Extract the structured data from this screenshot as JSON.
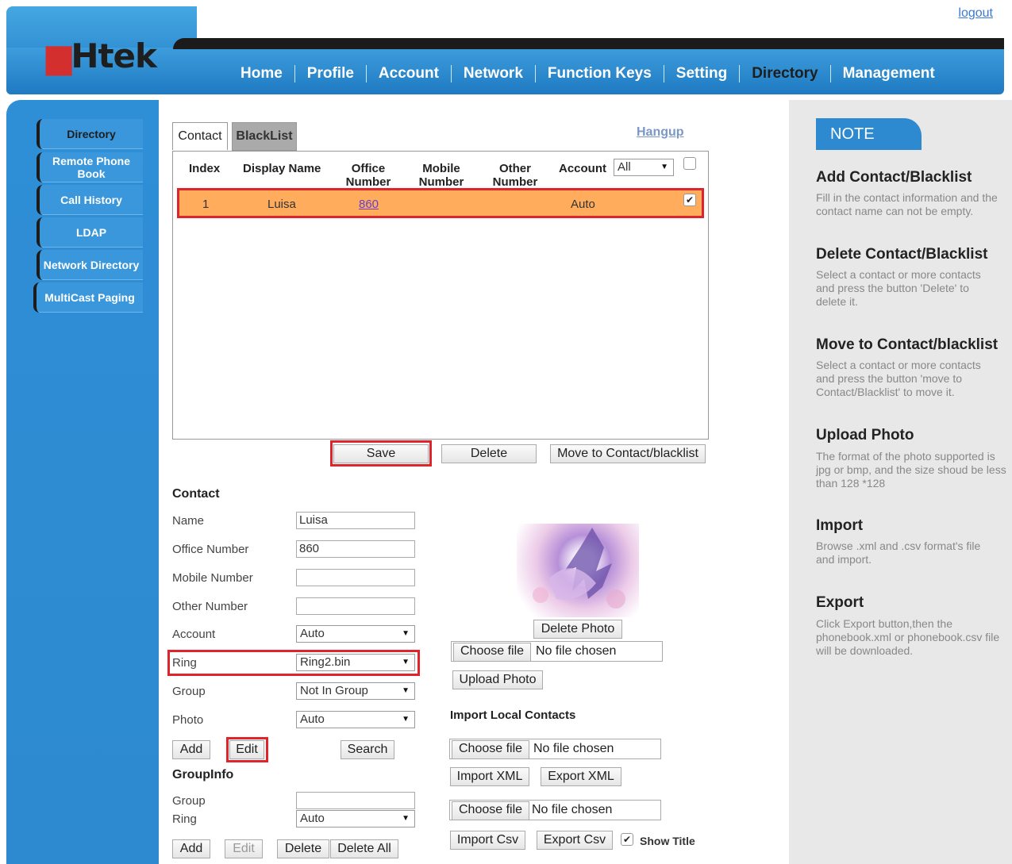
{
  "header": {
    "logo_text": "Htek",
    "logout": "logout",
    "nav": [
      "Home",
      "Profile",
      "Account",
      "Network",
      "Function Keys",
      "Setting",
      "Directory",
      "Management"
    ]
  },
  "sidebar": {
    "items": [
      "Directory",
      "Remote Phone Book",
      "Call History",
      "LDAP",
      "Network Directory",
      "MultiCast Paging"
    ]
  },
  "tabs": {
    "contact": "Contact",
    "blacklist": "BlackList",
    "hangup": "Hangup"
  },
  "table": {
    "headers": [
      "Index",
      "Display Name",
      "Office Number",
      "Mobile Number",
      "Other Number",
      "Account"
    ],
    "account_filter": "All",
    "rows": [
      {
        "index": "1",
        "name": "Luisa",
        "office": "860",
        "mobile": "",
        "other": "",
        "account": "Auto",
        "checked": true
      }
    ]
  },
  "list_buttons": {
    "save": "Save",
    "delete": "Delete",
    "move": "Move to Contact/blacklist"
  },
  "contact_form": {
    "title": "Contact",
    "name_label": "Name",
    "name_value": "Luisa",
    "office_label": "Office Number",
    "office_value": "860",
    "mobile_label": "Mobile Number",
    "mobile_value": "",
    "other_label": "Other Number",
    "other_value": "",
    "account_label": "Account",
    "account_value": "Auto",
    "ring_label": "Ring",
    "ring_value": "Ring2.bin",
    "group_label": "Group",
    "group_value": "Not In Group",
    "photo_label": "Photo",
    "photo_value": "Auto",
    "add": "Add",
    "edit": "Edit",
    "search": "Search"
  },
  "photo_panel": {
    "delete_photo": "Delete Photo",
    "choose_file": "Choose file",
    "no_file": "No file chosen",
    "upload_photo": "Upload Photo"
  },
  "import_panel": {
    "title": "Import Local Contacts",
    "choose_file": "Choose file",
    "no_file": "No file chosen",
    "import_xml": "Import XML",
    "export_xml": "Export XML",
    "import_csv": "Import Csv",
    "export_csv": "Export Csv",
    "show_title": "Show Title"
  },
  "groupinfo": {
    "title": "GroupInfo",
    "group_label": "Group",
    "group_value": "",
    "ring_label": "Ring",
    "ring_value": "Auto",
    "add": "Add",
    "edit": "Edit",
    "delete": "Delete",
    "delete_all": "Delete All"
  },
  "notes": {
    "badge": "NOTE",
    "sections": [
      {
        "title": "Add Contact/Blacklist",
        "text": "Fill in the contact information and the contact name can not be empty."
      },
      {
        "title": "Delete Contact/Blacklist",
        "text": "Select a contact or more contacts and press the button 'Delete' to delete it."
      },
      {
        "title": "Move to Contact/blacklist",
        "text": "Select a contact or more contacts and press the button 'move to Contact/Blacklist' to move it."
      },
      {
        "title": "Upload Photo",
        "text": "The format of the photo supported is jpg or bmp, and the size shoud be less than 128 *128"
      },
      {
        "title": "Import",
        "text": "Browse .xml and .csv format's file and import."
      },
      {
        "title": "Export",
        "text": "Click Export button,then the phonebook.xml or phonebook.csv file will be downloaded."
      }
    ]
  },
  "colors": {
    "header_blue": "#2d8ad0",
    "highlight_row": "#ffad5c",
    "annotation_red": "#e0242c"
  }
}
